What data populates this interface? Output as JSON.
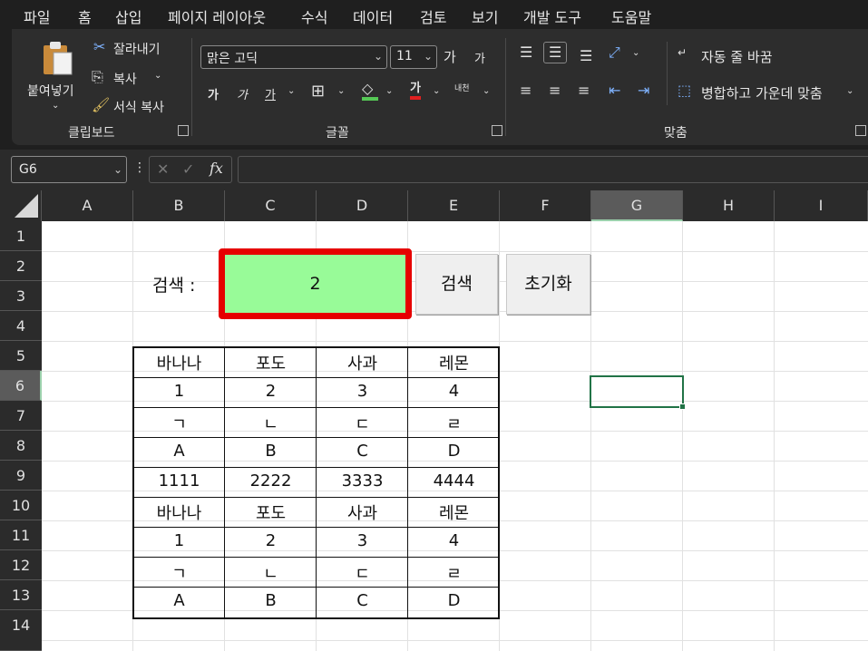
{
  "menu": [
    "파일",
    "홈",
    "삽입",
    "페이지 레이아웃",
    "수식",
    "데이터",
    "검토",
    "보기",
    "개발 도구",
    "도움말"
  ],
  "clipboard": {
    "paste": "붙여넣기",
    "cut": "잘라내기",
    "copy": "복사",
    "format_painter": "서식 복사",
    "group": "클립보드"
  },
  "font": {
    "name": "맑은 고딕",
    "size": "11",
    "grow": "가",
    "shrink": "가",
    "bold": "가",
    "italic": "가",
    "underline": "가",
    "color_letter": "가",
    "phonetic": "내천",
    "group": "글꼴"
  },
  "alignment": {
    "wrap": "자동 줄 바꿈",
    "merge": "병합하고 가운데 맞춤",
    "group": "맞춤"
  },
  "formula_bar": {
    "name_box": "G6",
    "cancel": "✕",
    "enter": "✓",
    "fx": "fx",
    "content": ""
  },
  "columns": [
    "A",
    "B",
    "C",
    "D",
    "E",
    "F",
    "G",
    "H",
    "I"
  ],
  "rows": [
    "1",
    "2",
    "3",
    "4",
    "5",
    "6",
    "7",
    "8",
    "9",
    "10",
    "11",
    "12",
    "13",
    "14"
  ],
  "search": {
    "label": "검색 :",
    "value": "2",
    "search_button": "검색",
    "reset_button": "초기화"
  },
  "table": [
    [
      "바나나",
      "포도",
      "사과",
      "레몬"
    ],
    [
      "1",
      "2",
      "3",
      "4"
    ],
    [
      "ㄱ",
      "ㄴ",
      "ㄷ",
      "ㄹ"
    ],
    [
      "A",
      "B",
      "C",
      "D"
    ],
    [
      "1111",
      "2222",
      "3333",
      "4444"
    ],
    [
      "바나나",
      "포도",
      "사과",
      "레몬"
    ],
    [
      "1",
      "2",
      "3",
      "4"
    ],
    [
      "ㄱ",
      "ㄴ",
      "ㄷ",
      "ㄹ"
    ],
    [
      "A",
      "B",
      "C",
      "D"
    ]
  ],
  "colors": {
    "search_box_fill": "#98fb98",
    "search_box_border": "#e60000",
    "selected_cell_border": "#217346",
    "accent": "#4caf7a"
  }
}
